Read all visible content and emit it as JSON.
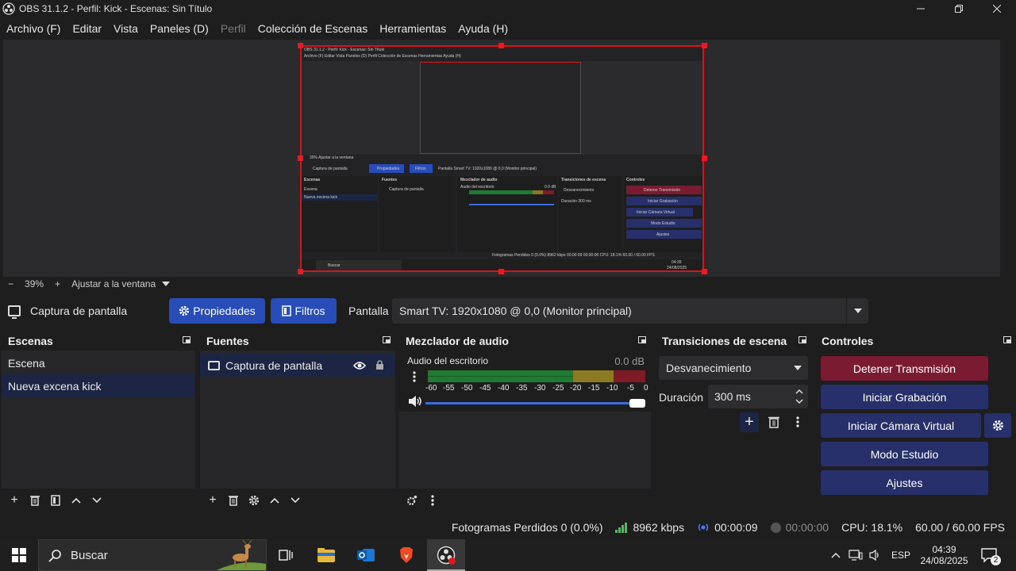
{
  "window": {
    "title": "OBS 31.1.2 - Perfil: Kick - Escenas: Sin Título",
    "controls": [
      "minimize",
      "maximize",
      "close"
    ]
  },
  "menu": [
    {
      "label": "Archivo (F)",
      "disabled": false
    },
    {
      "label": "Editar",
      "disabled": false
    },
    {
      "label": "Vista",
      "disabled": false
    },
    {
      "label": "Paneles (D)",
      "disabled": false
    },
    {
      "label": "Perfil",
      "disabled": true
    },
    {
      "label": "Colección de Escenas",
      "disabled": false
    },
    {
      "label": "Herramientas",
      "disabled": false
    },
    {
      "label": "Ayuda (H)",
      "disabled": false
    }
  ],
  "zoom": {
    "minus": "−",
    "value": "39%",
    "plus": "+",
    "fit_label": "Ajustar a la ventana"
  },
  "source_toolbar": {
    "source_name": "Captura de pantalla",
    "properties_label": "Propiedades",
    "filters_label": "Filtros",
    "display_label": "Pantalla",
    "display_value": "Smart TV: 1920x1080 @ 0,0 (Monitor principal)"
  },
  "scenes": {
    "title": "Escenas",
    "items": [
      "Escena",
      "Nueva excena kick"
    ],
    "selected_index": 1
  },
  "sources": {
    "title": "Fuentes",
    "items": [
      {
        "name": "Captura de pantalla",
        "visible": true,
        "locked": true
      }
    ]
  },
  "mixer": {
    "title": "Mezclador de audio",
    "channel_name": "Audio del escritorio",
    "level": "0.0 dB",
    "scale": [
      "-60",
      "-55",
      "-50",
      "-45",
      "-40",
      "-35",
      "-30",
      "-25",
      "-20",
      "-15",
      "-10",
      "-5",
      "0"
    ],
    "volume": 1.0
  },
  "transitions": {
    "title": "Transiciones de escena",
    "selected": "Desvanecimiento",
    "duration_label": "Duración",
    "duration_value": "300 ms"
  },
  "controls": {
    "title": "Controles",
    "stop_stream": "Detener Transmisión",
    "start_recording": "Iniciar Grabación",
    "start_virtual_cam": "Iniciar Cámara Virtual",
    "studio_mode": "Modo Estudio",
    "settings": "Ajustes"
  },
  "status": {
    "dropped_frames": "Fotogramas Perdidos 0 (0.0%)",
    "bitrate": "8962 kbps",
    "stream_time": "00:00:09",
    "record_time": "00:00:00",
    "cpu": "CPU: 18.1%",
    "fps": "60.00 / 60.00 FPS"
  },
  "taskbar": {
    "search_placeholder": "Buscar",
    "language": "ESP",
    "time": "04:39",
    "date": "24/08/2025",
    "notifications": "2"
  },
  "mini": {
    "title": "OBS 31.1.2 - Perfil: Kick - Escenas: Sin Título",
    "menu": "Archivo (F)   Editar   Vista   Paneles (D)   Perfil   Colección de Escenas   Herramientas   Ayuda (H)",
    "zoom": "39%     Ajustar a la ventana",
    "source": "Captura de pantalla",
    "props": "Propiedades",
    "filters": "Filtros",
    "display": "Pantalla    Smart TV: 1920x1080 @ 0,0 (Monitor principal)",
    "scenes_title": "Escenas",
    "scene1": "Escena",
    "scene2": "Nueva excena kick",
    "sources_title": "Fuentes",
    "source1": "Captura de pantalla",
    "mixer_title": "Mezclador de audio",
    "mixer_channel": "Audio del escritorio",
    "mixer_db": "0.0 dB",
    "trans_title": "Transiciones de escena",
    "trans_sel": "Desvanecimiento",
    "trans_dur": "Duración    300 ms",
    "ctrl_title": "Controles",
    "c1": "Detener Transmisión",
    "c2": "Iniciar Grabación",
    "c3": "Iniciar Cámara Virtual",
    "c4": "Modo Estudio",
    "c5": "Ajustes",
    "status": "Fotogramas Perdidos 0 (0.0%)   8962 kbps   00:00:09   00:00:00   CPU: 18.1%   60.00 / 60.00 FPS",
    "search": "Buscar",
    "time": "04:39",
    "date": "24/08/2025"
  },
  "colors": {
    "background": "#1f1e1f",
    "accent_blue": "#284cb8",
    "stop_button": "#7a1b32",
    "control_button": "#28306b",
    "selection": "#1c2543",
    "preview_border": "#d8131c",
    "meter_green": "#1f7b32",
    "meter_yellow": "#8b7a22",
    "meter_red": "#7f1b24"
  }
}
